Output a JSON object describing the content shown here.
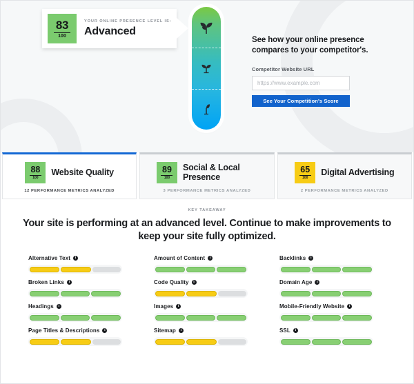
{
  "hero": {
    "score": "83",
    "score_denominator": "100",
    "kicker": "YOUR ONLINE PRESENCE LEVEL IS:",
    "level": "Advanced",
    "thermometer": {
      "segments": [
        "advanced-sprout",
        "intermediate-sprout",
        "beginner-sprout"
      ],
      "gradient_top": "#7ac943",
      "gradient_bottom": "#00a3f5"
    }
  },
  "competitor": {
    "heading": "See how your online presence compares to your competitor's.",
    "field_label": "Competitor Website URL",
    "input_value": "",
    "input_placeholder": "https://www.example.com",
    "button_label": "See Your Competition's Score",
    "button_color": "#1263cc"
  },
  "categories": [
    {
      "score": "88",
      "denominator": "100",
      "title": "Website Quality",
      "subtitle": "12 PERFORMANCE METRICS ANALYZED",
      "chip_color": "green",
      "active": true
    },
    {
      "score": "89",
      "denominator": "100",
      "title": "Social & Local Presence",
      "subtitle": "3 PERFORMANCE METRICS ANALYZED",
      "chip_color": "green",
      "active": false
    },
    {
      "score": "65",
      "denominator": "100",
      "title": "Digital Advertising",
      "subtitle": "2 PERFORMANCE METRICS ANALYZED",
      "chip_color": "yellow",
      "active": false
    }
  ],
  "takeaway": {
    "kicker": "KEY TAKEAWAY",
    "text": "Your site is performing at an advanced level. Continue to make improvements to keep your site fully optimized."
  },
  "metrics_info_glyph": "i",
  "metrics": [
    {
      "name": "Alternative Text",
      "segments": [
        "yellow",
        "yellow",
        "empty"
      ]
    },
    {
      "name": "Amount of Content",
      "segments": [
        "green",
        "green",
        "green"
      ]
    },
    {
      "name": "Backlinks",
      "segments": [
        "green",
        "green",
        "green"
      ]
    },
    {
      "name": "Broken Links",
      "segments": [
        "green",
        "green",
        "green"
      ]
    },
    {
      "name": "Code Quality",
      "segments": [
        "yellow",
        "yellow",
        "empty"
      ]
    },
    {
      "name": "Domain Age",
      "segments": [
        "green",
        "green",
        "green"
      ]
    },
    {
      "name": "Headings",
      "segments": [
        "green",
        "green",
        "green"
      ]
    },
    {
      "name": "Images",
      "segments": [
        "green",
        "green",
        "green"
      ]
    },
    {
      "name": "Mobile-Friendly Website",
      "segments": [
        "green",
        "green",
        "green"
      ]
    },
    {
      "name": "Page Titles & Descriptions",
      "segments": [
        "yellow",
        "yellow",
        "empty"
      ]
    },
    {
      "name": "Sitemap",
      "segments": [
        "yellow",
        "yellow",
        "empty"
      ]
    },
    {
      "name": "SSL",
      "segments": [
        "green",
        "green",
        "green"
      ]
    }
  ]
}
